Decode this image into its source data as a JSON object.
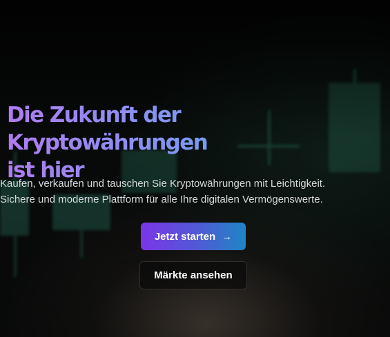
{
  "hero": {
    "headline_line1": "Die Zukunft der Kryptowährungen",
    "headline_line2": "ist hier",
    "subtitle_line1": "Kaufen, verkaufen und tauschen Sie Kryptowährungen mit Leichtigkeit.",
    "subtitle_line2": "Sichere und moderne Plattform für alle Ihre digitalen Vermögenswerte.",
    "primary_button": {
      "label": "Jetzt starten",
      "icon": "arrow-right-icon",
      "glyph": "→"
    },
    "secondary_button": {
      "label": "Märkte ansehen"
    }
  },
  "colors": {
    "background": "#060807",
    "headline_gradient_start": "#b07cf0",
    "headline_gradient_end": "#4ec0e6",
    "primary_button_start": "#7b35e8",
    "primary_button_end": "#1e86c4",
    "candle_green": "#2f7f68"
  }
}
